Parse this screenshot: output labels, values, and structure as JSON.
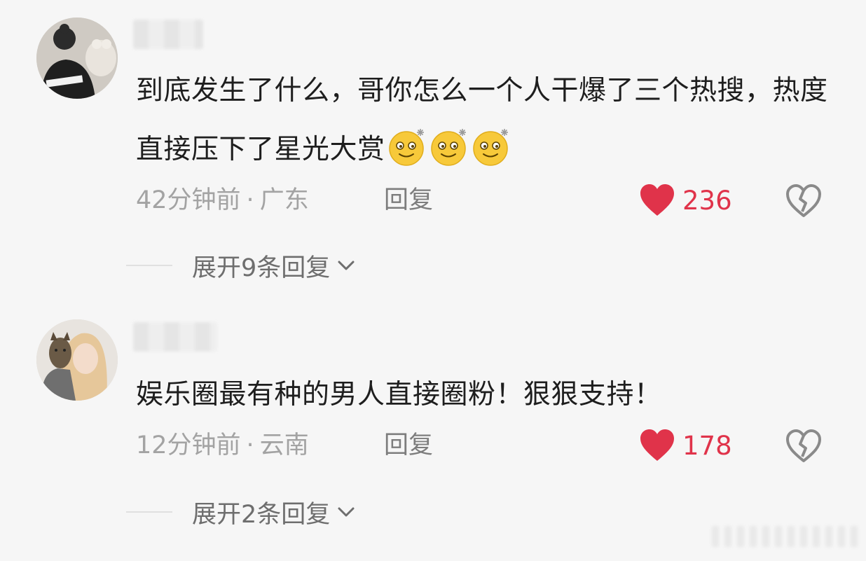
{
  "comments": [
    {
      "text": "到底发生了什么，哥你怎么一个人干爆了三个热搜，热度直接压下了星光大赏",
      "emoji_icon": "dizzy-face-emoji",
      "emoji_count": 3,
      "time": "42分钟前",
      "location": "广东",
      "reply_label": "回复",
      "likes": "236",
      "expand_label": "展开9条回复"
    },
    {
      "text": "娱乐圈最有种的男人直接圈粉！狠狠支持！",
      "time": "12分钟前",
      "location": "云南",
      "reply_label": "回复",
      "likes": "178",
      "expand_label": "展开2条回复"
    }
  ],
  "colors": {
    "like": "#e0334a",
    "background": "#f6f6f6",
    "text": "#1e1e1e",
    "meta": "#a3a3a3"
  }
}
